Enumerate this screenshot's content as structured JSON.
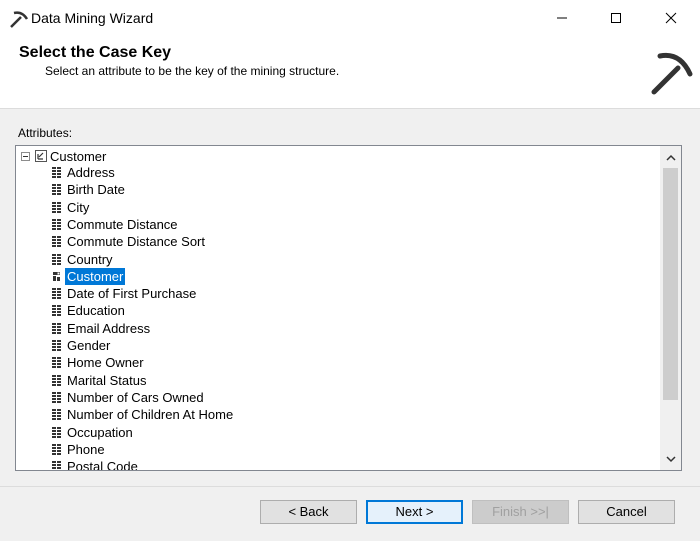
{
  "window": {
    "title": "Data Mining Wizard"
  },
  "header": {
    "title": "Select the Case Key",
    "subtitle": "Select an attribute to be the key of the mining structure."
  },
  "attributes_label": "Attributes:",
  "tree": {
    "root": {
      "label": "Customer",
      "expanded": true,
      "icon": "dimension-icon"
    },
    "items": [
      {
        "label": "Address",
        "icon": "attribute-icon",
        "selected": false
      },
      {
        "label": "Birth Date",
        "icon": "attribute-icon",
        "selected": false
      },
      {
        "label": "City",
        "icon": "attribute-icon",
        "selected": false
      },
      {
        "label": "Commute Distance",
        "icon": "attribute-icon",
        "selected": false
      },
      {
        "label": "Commute Distance Sort",
        "icon": "attribute-icon",
        "selected": false
      },
      {
        "label": "Country",
        "icon": "attribute-icon",
        "selected": false
      },
      {
        "label": "Customer",
        "icon": "key-attribute-icon",
        "selected": true
      },
      {
        "label": "Date of First Purchase",
        "icon": "attribute-icon",
        "selected": false
      },
      {
        "label": "Education",
        "icon": "attribute-icon",
        "selected": false
      },
      {
        "label": "Email Address",
        "icon": "attribute-icon",
        "selected": false
      },
      {
        "label": "Gender",
        "icon": "attribute-icon",
        "selected": false
      },
      {
        "label": "Home Owner",
        "icon": "attribute-icon",
        "selected": false
      },
      {
        "label": "Marital Status",
        "icon": "attribute-icon",
        "selected": false
      },
      {
        "label": "Number of Cars Owned",
        "icon": "attribute-icon",
        "selected": false
      },
      {
        "label": "Number of Children At Home",
        "icon": "attribute-icon",
        "selected": false
      },
      {
        "label": "Occupation",
        "icon": "attribute-icon",
        "selected": false
      },
      {
        "label": "Phone",
        "icon": "attribute-icon",
        "selected": false
      },
      {
        "label": "Postal Code",
        "icon": "attribute-icon",
        "selected": false
      }
    ]
  },
  "buttons": {
    "back": "< Back",
    "next": "Next >",
    "finish": "Finish >>|",
    "cancel": "Cancel"
  },
  "colors": {
    "selection": "#0078d7",
    "default_button_border": "#0078d7"
  }
}
